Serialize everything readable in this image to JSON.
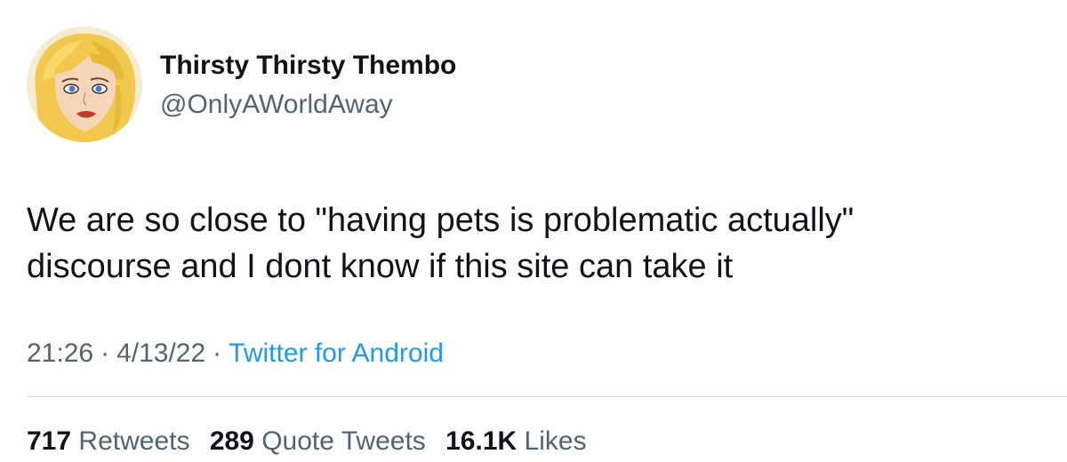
{
  "tweet": {
    "author": {
      "display_name": "Thirsty Thirsty Thembo",
      "handle": "@OnlyAWorldAway",
      "avatar_icon": "cartoon-woman-portrait"
    },
    "text_lines": [
      "We are so close to \"having pets is problematic actually\"",
      "discourse and I dont know if this site can take it"
    ],
    "time": "21:26",
    "date": "4/13/22",
    "separator": "·",
    "source": "Twitter for Android",
    "stats": {
      "retweets": {
        "count": "717",
        "label": "Retweets"
      },
      "quote_tweets": {
        "count": "289",
        "label": "Quote Tweets"
      },
      "likes": {
        "count": "16.1K",
        "label": "Likes"
      }
    }
  },
  "colors": {
    "primary_text": "#0f1419",
    "secondary_text": "#536471",
    "link": "#1d9bf0",
    "divider": "#cfd9de",
    "background": "#ffffff"
  }
}
